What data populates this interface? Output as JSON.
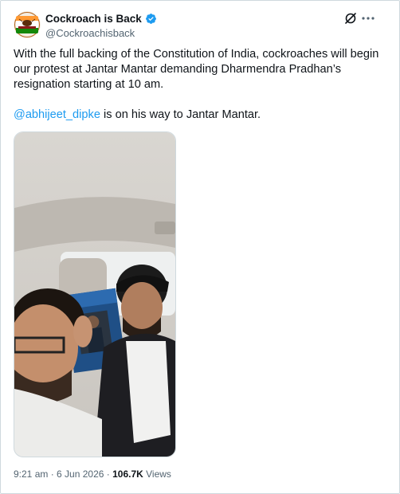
{
  "author": {
    "display_name": "Cockroach is Back",
    "handle": "@Cockroachisback",
    "verified": true,
    "avatar_icon": "party-logo-avatar"
  },
  "actions": {
    "grok_icon": "grok-icon",
    "more_icon": "more-options-icon"
  },
  "tweet": {
    "paragraph_1": "With the full backing of the Constitution of India, cockroaches will begin our protest at Jantar Mantar demanding Dharmendra Pradhan’s resignation starting at 10 am.",
    "mention": "@abhijeet_dipke",
    "paragraph_2_rest": " is on his way to Jantar Mantar."
  },
  "media": {
    "type": "photo",
    "description_icon": "selfie-photo"
  },
  "meta": {
    "time": "9:21 am",
    "separator": " · ",
    "date": "6 Jun 2026",
    "views_count": "106.7K",
    "views_label": " Views"
  },
  "colors": {
    "accent": "#1d9bf0",
    "text_primary": "#0f1419",
    "text_secondary": "#536471",
    "border": "#cfd9de"
  }
}
